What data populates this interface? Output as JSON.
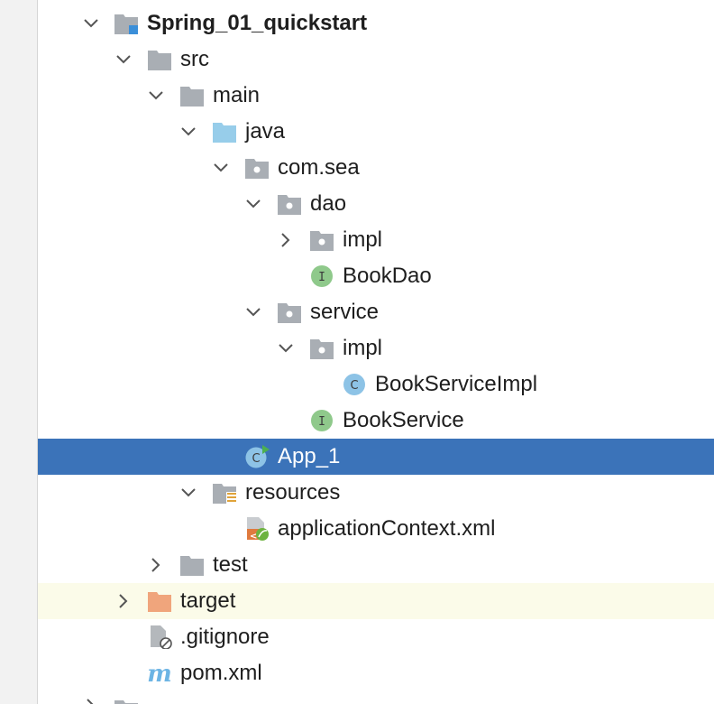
{
  "project_tree": {
    "root": {
      "label": "Spring_01_quickstart"
    },
    "src": {
      "label": "src"
    },
    "main": {
      "label": "main"
    },
    "java": {
      "label": "java"
    },
    "com_sea": {
      "label": "com.sea"
    },
    "dao": {
      "label": "dao"
    },
    "dao_impl": {
      "label": "impl"
    },
    "book_dao": {
      "label": "BookDao"
    },
    "service": {
      "label": "service"
    },
    "service_impl": {
      "label": "impl"
    },
    "book_service_impl": {
      "label": "BookServiceImpl"
    },
    "book_service": {
      "label": "BookService"
    },
    "app_1": {
      "label": "App_1"
    },
    "resources": {
      "label": "resources"
    },
    "application_context": {
      "label": "applicationContext.xml"
    },
    "test": {
      "label": "test"
    },
    "target": {
      "label": "target"
    },
    "gitignore": {
      "label": ".gitignore"
    },
    "pom": {
      "label": "pom.xml"
    }
  },
  "colors": {
    "selection": "#3b73b9",
    "ignored_row": "#fbfbe9",
    "folder_gray": "#a9aeb4",
    "folder_blue": "#97cdea",
    "folder_orange": "#f0a57c",
    "interface_green": "#8fc98b",
    "class_blue": "#8dc3e6",
    "maven_blue": "#6cb4e4"
  }
}
